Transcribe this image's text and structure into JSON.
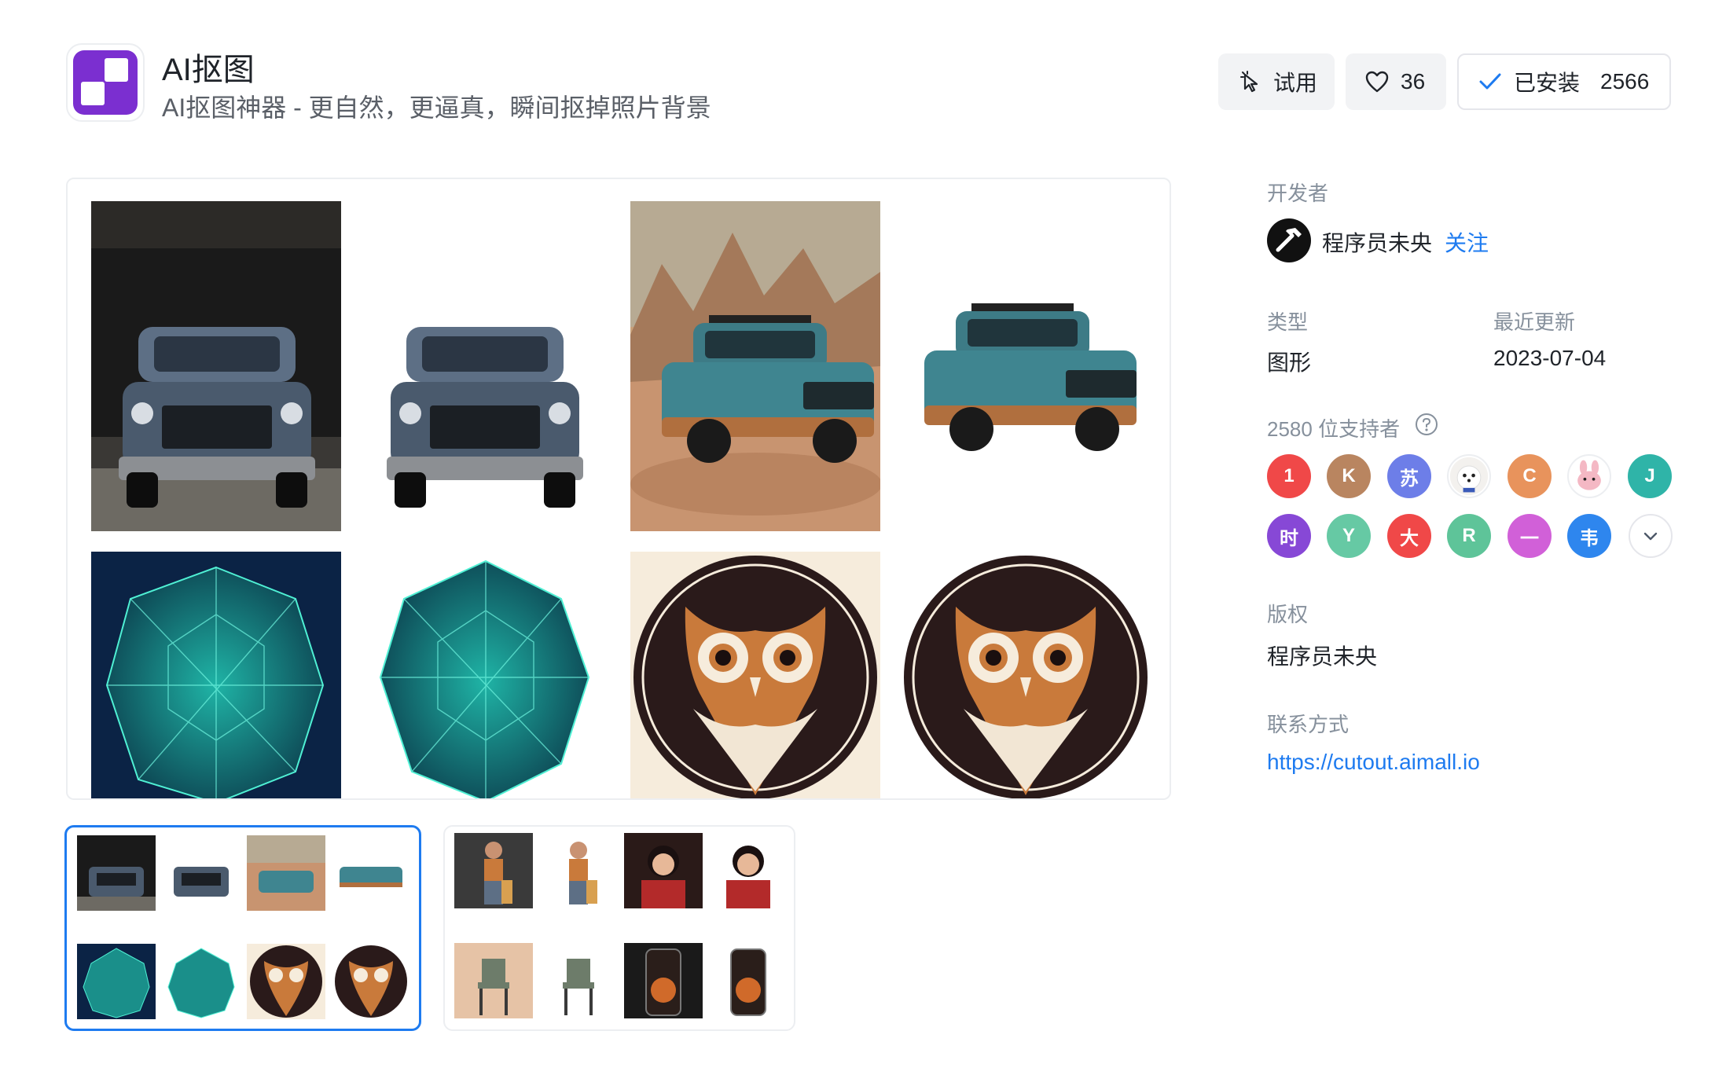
{
  "app": {
    "title": "AI抠图",
    "subtitle": "AI抠图神器 - 更自然，更逼真，瞬间抠掉照片背景",
    "icon": "cutout-app-icon",
    "icon_color": "#7b2fd0"
  },
  "actions": {
    "try_label": "试用",
    "try_icon": "pointer-click-icon",
    "like_count": "36",
    "like_icon": "heart-icon",
    "installed_label": "已安装",
    "installed_count": "2566",
    "installed_icon": "check-icon",
    "accent": "#1e7bf0"
  },
  "sidebar": {
    "developer_label": "开发者",
    "developer_name": "程序员未央",
    "developer_avatar_icon": "hammer-icon",
    "follow_label": "关注",
    "type_label": "类型",
    "type_value": "图形",
    "updated_label": "最近更新",
    "updated_value": "2023-07-04",
    "supporters_label": "2580 位支持者",
    "supporters": [
      {
        "text": "1",
        "color": "#f04848"
      },
      {
        "text": "K",
        "color": "#b98560"
      },
      {
        "text": "苏",
        "color": "#6d7ee8"
      },
      {
        "text": "",
        "color": "#ffffff"
      },
      {
        "text": "C",
        "color": "#e8935c"
      },
      {
        "text": "",
        "color": "#ffffff"
      },
      {
        "text": "J",
        "color": "#2fb4a8"
      },
      {
        "text": "时",
        "color": "#8748d6"
      },
      {
        "text": "Y",
        "color": "#66c9a4"
      },
      {
        "text": "大",
        "color": "#f04848"
      },
      {
        "text": "R",
        "color": "#5ec499"
      },
      {
        "text": "一",
        "color": "#d160d8"
      },
      {
        "text": "韦",
        "color": "#2e86ee"
      }
    ],
    "copyright_label": "版权",
    "copyright_value": "程序员未央",
    "contact_label": "联系方式",
    "contact_url": "https://cutout.aimall.io"
  }
}
